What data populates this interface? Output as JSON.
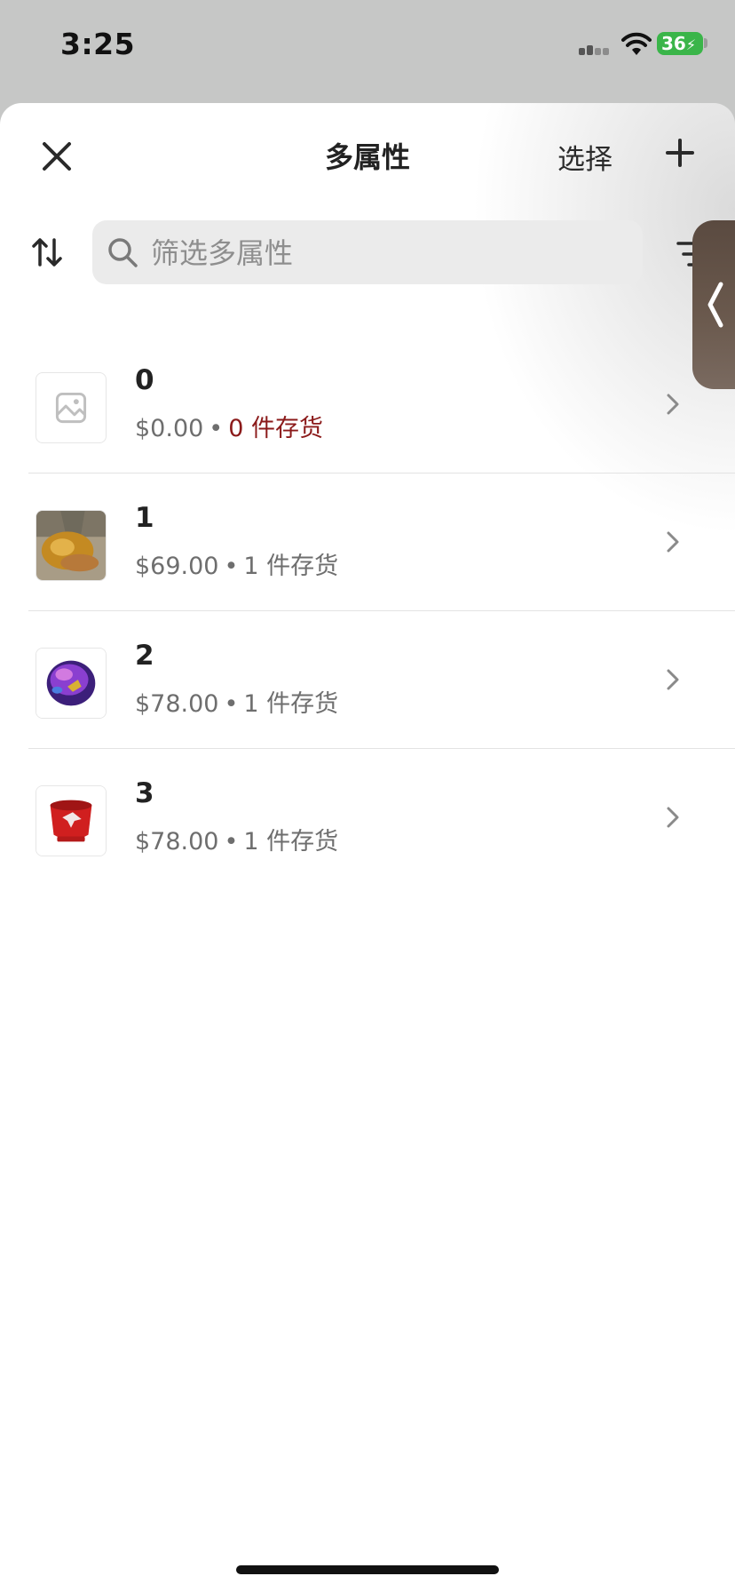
{
  "status_bar": {
    "time": "3:25",
    "battery": "36"
  },
  "header": {
    "title": "多属性",
    "select_label": "选择"
  },
  "search": {
    "placeholder": "筛选多属性"
  },
  "variants": [
    {
      "name": "0",
      "price": "$0.00",
      "stock": "0 件存货",
      "stock_zero": true
    },
    {
      "name": "1",
      "price": "$69.00",
      "stock": "1 件存货",
      "stock_zero": false
    },
    {
      "name": "2",
      "price": "$78.00",
      "stock": "1 件存货",
      "stock_zero": false
    },
    {
      "name": "3",
      "price": "$78.00",
      "stock": "1 件存货",
      "stock_zero": false
    }
  ],
  "separator": "•",
  "colors": {
    "out_of_stock": "#8b1a1a",
    "battery": "#3ab549"
  }
}
